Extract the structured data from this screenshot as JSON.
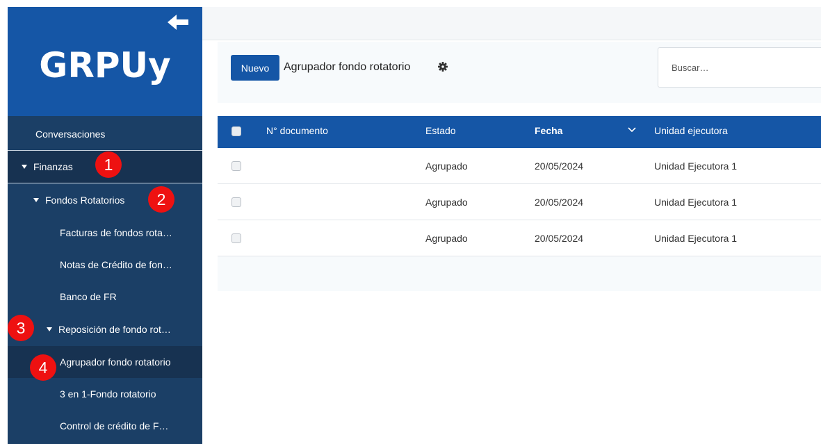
{
  "sidebar": {
    "logo": "GRPUy",
    "items": [
      {
        "label": "Conversaciones"
      },
      {
        "label": "Finanzas"
      },
      {
        "label": "Fondos Rotatorios"
      },
      {
        "label": "Facturas de fondos rota…"
      },
      {
        "label": "Notas de Crédito de fon…"
      },
      {
        "label": "Banco de FR"
      },
      {
        "label": "Reposición de fondo rot…"
      },
      {
        "label": "Agrupador fondo rotatorio"
      },
      {
        "label": "3 en 1-Fondo rotatorio"
      },
      {
        "label": "Control de crédito de F…"
      }
    ]
  },
  "annotations": [
    "1",
    "2",
    "3",
    "4"
  ],
  "toolbar": {
    "new_label": "Nuevo",
    "title": "Agrupador fondo rotatorio",
    "search_placeholder": "Buscar…"
  },
  "table": {
    "columns": [
      "N° documento",
      "Estado",
      "Fecha",
      "Unidad ejecutora"
    ],
    "rows": [
      {
        "documento": "",
        "estado": "Agrupado",
        "fecha": "20/05/2024",
        "unidad": "Unidad Ejecutora 1"
      },
      {
        "documento": "",
        "estado": "Agrupado",
        "fecha": "20/05/2024",
        "unidad": "Unidad Ejecutora 1"
      },
      {
        "documento": "",
        "estado": "Agrupado",
        "fecha": "20/05/2024",
        "unidad": "Unidad Ejecutora 1"
      }
    ]
  },
  "colors": {
    "brand_blue": "#1556a6",
    "sidebar_dark": "#1b3f66",
    "annotation_red": "#ee1111"
  }
}
